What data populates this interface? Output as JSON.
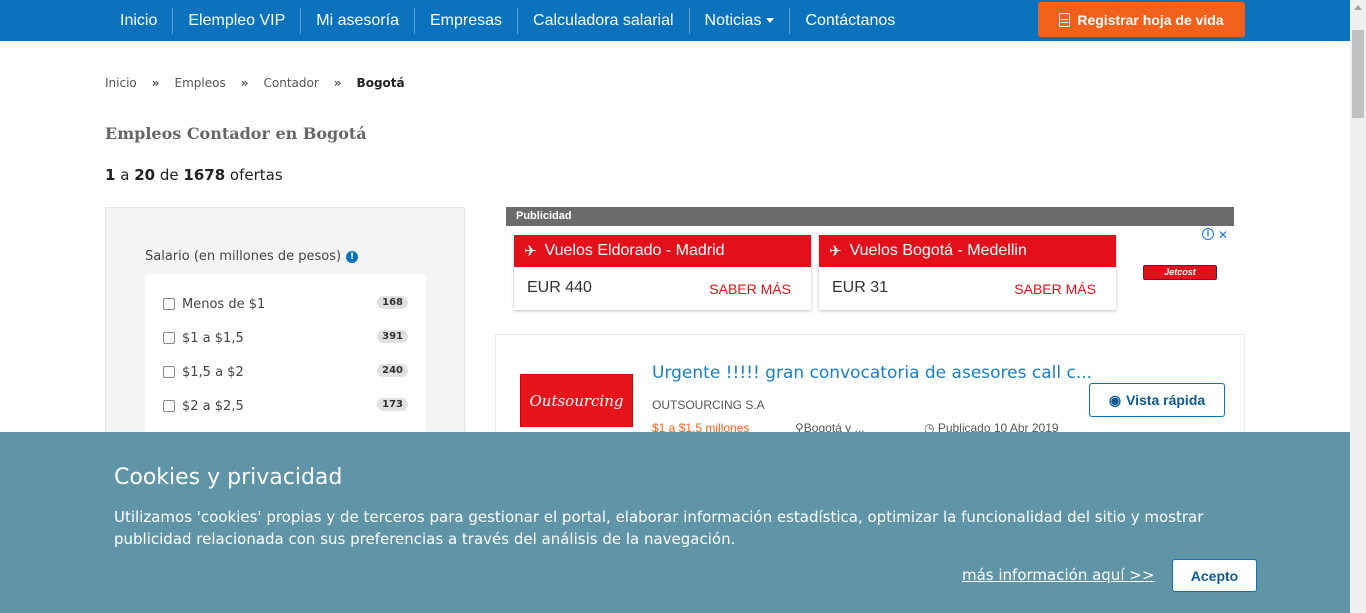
{
  "nav": {
    "items": [
      "Inicio",
      "Elempleo VIP",
      "Mi asesoría",
      "Empresas",
      "Calculadora salarial",
      "Noticias",
      "Contáctanos"
    ],
    "register_button": "Registrar hoja de vida",
    "color": "#0b72bd",
    "register_color": "#f2611b"
  },
  "breadcrumb": {
    "items": [
      "Inicio",
      "Empleos",
      "Contador"
    ],
    "separator": "»",
    "current": "Bogotá"
  },
  "page_title": "Empleos Contador en Bogotá",
  "results": {
    "from": "1",
    "a": "a",
    "to": "20",
    "de": "de",
    "total": "1678",
    "suffix": "ofertas"
  },
  "filter": {
    "title": "Salario (en millones de pesos)",
    "options": [
      {
        "label": "Menos de $1",
        "count": "168"
      },
      {
        "label": "$1 a $1,5",
        "count": "391"
      },
      {
        "label": "$1,5 a $2",
        "count": "240"
      },
      {
        "label": "$2 a $2,5",
        "count": "173"
      }
    ]
  },
  "ad": {
    "header": "Publicidad",
    "cards": [
      {
        "title": "Vuelos Eldorado - Madrid",
        "price": "EUR 440",
        "cta": "SABER MÁS"
      },
      {
        "title": "Vuelos Bogotá - Medellin",
        "price": "EUR 31",
        "cta": "SABER MÁS"
      }
    ],
    "brand": "Jetcost",
    "accent": "#e30f1b"
  },
  "job": {
    "logo_text": "Outsourcing",
    "title": "Urgente !!!!! gran convocatoria de asesores call c...",
    "company": "OUTSOURCING S.A",
    "salary": "$1 a $1,5 millones",
    "location": "Bogotá y ...",
    "date": "Publicado 10 Abr 2019",
    "quick_view": "Vista rápida"
  },
  "cookies": {
    "title": "Cookies y privacidad",
    "text": "Utilizamos 'cookies' propias y de terceros para gestionar el portal, elaborar información estadística, optimizar la funcionalidad del sitio y mostrar publicidad relacionada con sus preferencias a través del análisis de la navegación.",
    "more_link": "más información aquí >>",
    "accept": "Acepto",
    "background": "#5f95a6"
  }
}
